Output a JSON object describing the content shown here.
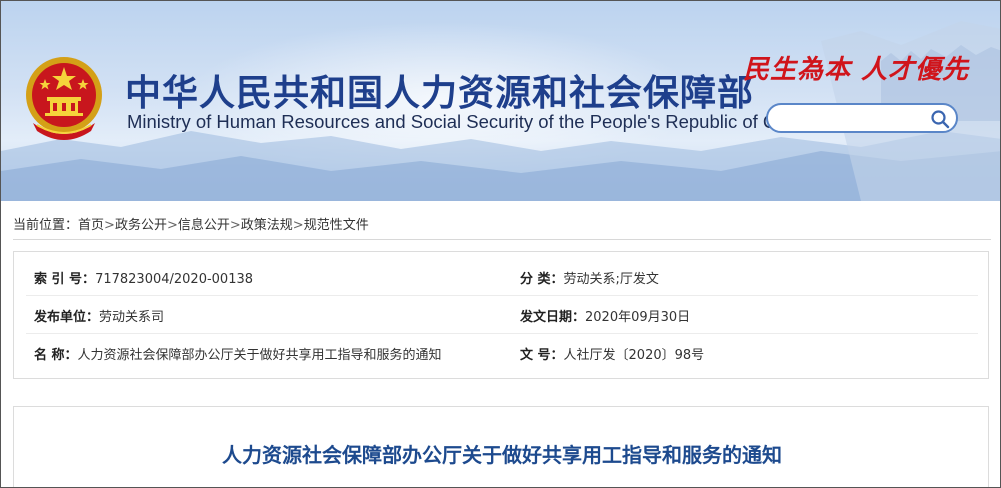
{
  "header": {
    "title_cn": "中华人民共和国人力资源和社会保障部",
    "title_en": "Ministry of Human Resources and Social Security of the People's Republic of China",
    "slogan": "民生為本  人才優先",
    "search": {
      "placeholder": "",
      "value": ""
    },
    "colors": {
      "title": "#1e3f8c",
      "slogan": "#d0141b",
      "search_border": "#5a86c8"
    }
  },
  "breadcrumb": {
    "prefix": "当前位置：",
    "items": [
      "首页",
      "政务公开",
      "信息公开",
      "政策法规",
      "规范性文件"
    ],
    "separator": ">"
  },
  "info": {
    "index_label": "索 引 号：",
    "index_value": "717823004/2020-00138",
    "category_label": "分    类：",
    "category_value": "劳动关系;厅发文",
    "publisher_label": "发布单位：",
    "publisher_value": "劳动关系司",
    "date_label": "发文日期：",
    "date_value": "2020年09月30日",
    "name_label": "名    称：",
    "name_value": "人力资源社会保障部办公厅关于做好共享用工指导和服务的通知",
    "docno_label": "文    号：",
    "docno_value": "人社厅发〔2020〕98号"
  },
  "article": {
    "title": "人力资源社会保障部办公厅关于做好共享用工指导和服务的通知",
    "title_color": "#1d4a8e"
  }
}
